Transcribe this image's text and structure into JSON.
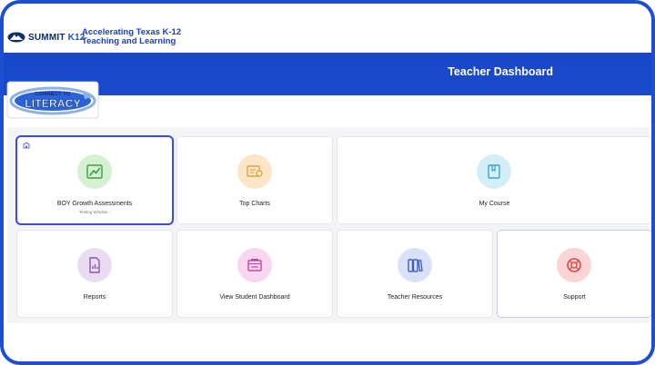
{
  "brand": {
    "logo_name": "SUMMIT",
    "logo_k12": "K12",
    "tagline_line1": "Accelerating Texas K-12",
    "tagline_line2": "Teaching and Learning"
  },
  "header": {
    "title": "Teacher Dashboard"
  },
  "badge": {
    "connect": "CONNECT TO",
    "literacy": "LITERACY"
  },
  "tiles": [
    {
      "label": "BOY Growth Assessments",
      "sub": "Testing Window -",
      "icon": "chart-up-icon",
      "color": "#d6f0d2"
    },
    {
      "label": "Top Charts",
      "icon": "certificate-icon",
      "color": "#fde6c8"
    },
    {
      "label": "My Course",
      "icon": "book-icon",
      "color": "#d3eef7"
    },
    {
      "label": "Reports",
      "icon": "report-icon",
      "color": "#e9dcf1"
    },
    {
      "label": "View Student Dashboard",
      "icon": "dashboard-icon",
      "color": "#f8d6ef"
    },
    {
      "label": "Teacher Resources",
      "icon": "binders-icon",
      "color": "#d9e1f6"
    },
    {
      "label": "Support",
      "icon": "lifebuoy-icon",
      "color": "#fbd5d5"
    }
  ],
  "colors": {
    "brand_blue": "#1a4fd6",
    "header_blue": "#1947c9",
    "selected_outline": "#3b49e6"
  }
}
